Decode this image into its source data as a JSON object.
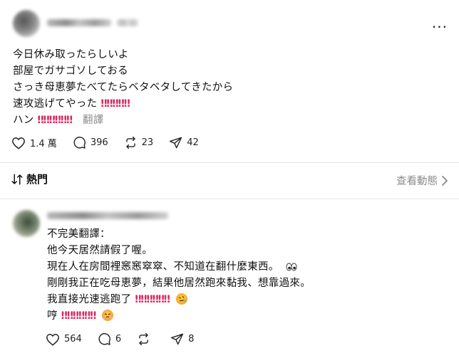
{
  "post": {
    "author_name": "",
    "timestamp": "",
    "more_label": "···",
    "lines": [
      "今日休み取ったらしいよ",
      "部屋でガサゴソしておる",
      "さっき母恵夢たべてたらベタベタしてきたから",
      "速攻逃げてやった",
      "ハン"
    ],
    "bangs_line4": "‼‼‼‼‼",
    "bangs_line5": "‼‼‼‼‼‼",
    "translate_label": "翻譯",
    "likes": "1.4 萬",
    "comments": "396",
    "reposts": "23",
    "shares": "42"
  },
  "sort": {
    "label": "熱門",
    "view_activity": "查看動態"
  },
  "reply": {
    "author_name": "",
    "lines": [
      "不完美翻譯：",
      "他今天居然請假了喔。",
      "現在人在房間裡窸窸窣窣、不知道在翻什麼東西。",
      "剛剛我正在吃母恵夢，結果他居然跑來黏我、想靠過來。",
      "我直接光速逃跑了",
      "哼"
    ],
    "bangs_line5": "‼‼‼‼‼‼",
    "bangs_line6": "‼‼‼‼‼‼",
    "likes": "564",
    "comments": "6",
    "reposts": "",
    "shares": "8"
  },
  "icons": {
    "heart": "heart-icon",
    "comment": "comment-icon",
    "repost": "repost-icon",
    "share": "share-icon",
    "sort": "sort-icon",
    "chevron": "chevron-right-icon",
    "more": "more-icon"
  },
  "colors": {
    "bang_red": "#e0245e",
    "muted": "#8a8a8a",
    "divider": "#e6e6e6"
  }
}
